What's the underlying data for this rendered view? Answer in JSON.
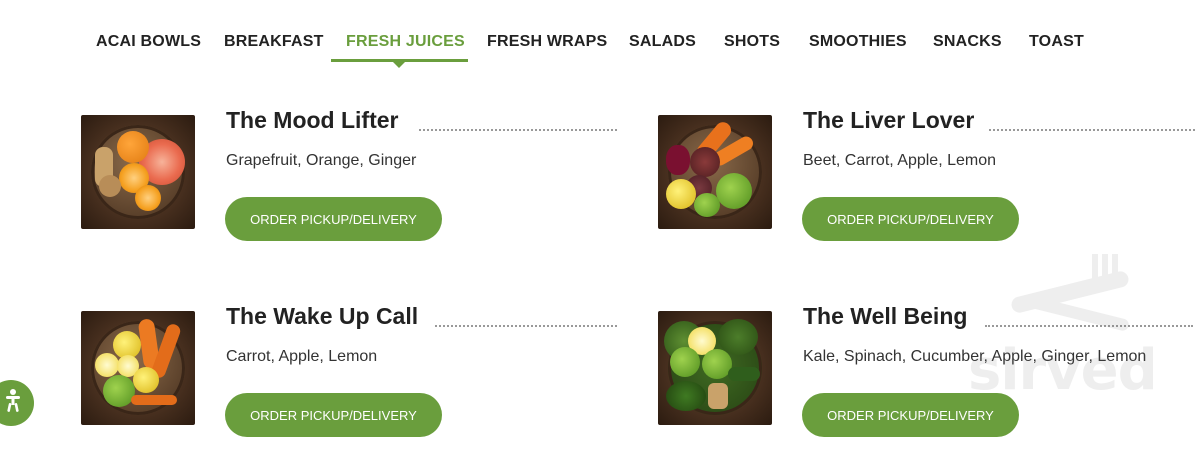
{
  "tabs": [
    {
      "label": "ACAI BOWLS"
    },
    {
      "label": "BREAKFAST"
    },
    {
      "label": "FRESH JUICES",
      "active": true
    },
    {
      "label": "FRESH WRAPS"
    },
    {
      "label": "SALADS"
    },
    {
      "label": "SHOTS"
    },
    {
      "label": "SMOOTHIES"
    },
    {
      "label": "SNACKS"
    },
    {
      "label": "TOAST"
    }
  ],
  "items": [
    {
      "name": "The Mood Lifter",
      "ingredients": "Grapefruit, Orange, Ginger",
      "button": "ORDER PICKUP/DELIVERY"
    },
    {
      "name": "The Liver Lover",
      "ingredients": "Beet, Carrot, Apple, Lemon",
      "button": "ORDER PICKUP/DELIVERY"
    },
    {
      "name": "The Wake Up Call",
      "ingredients": "Carrot, Apple, Lemon",
      "button": "ORDER PICKUP/DELIVERY"
    },
    {
      "name": "The Well Being",
      "ingredients": "Kale, Spinach, Cucumber, Apple, Ginger, Lemon",
      "button": "ORDER PICKUP/DELIVERY"
    }
  ],
  "watermark": {
    "text": "sirved",
    "icon": "fork-knife-icon"
  },
  "accessibility": {
    "icon": "accessibility-person-icon"
  },
  "colors": {
    "accent": "#6a9e3d",
    "text": "#222222"
  }
}
